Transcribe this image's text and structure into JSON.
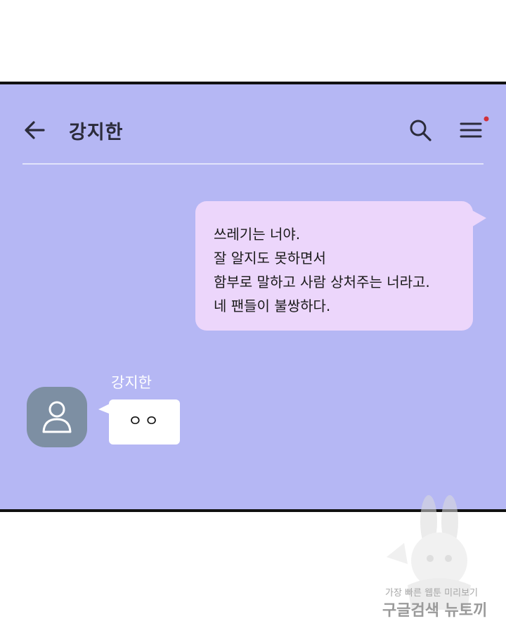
{
  "header": {
    "title": "강지한",
    "back_icon": "arrow-left-icon",
    "search_icon": "search-icon",
    "menu_icon": "hamburger-menu-icon",
    "notification_dot_color": "#d0303a"
  },
  "colors": {
    "panel_background": "#b5b7f4",
    "outgoing_bubble": "#ecd6fb",
    "incoming_bubble": "#ffffff",
    "avatar_background": "#7d8fa3"
  },
  "messages": {
    "outgoing": {
      "lines": [
        "쓰레기는 너야.",
        "잘 알지도 못하면서",
        "함부로 말하고 사람 상처주는 너라고.",
        "네 팬들이 불쌍하다."
      ]
    },
    "incoming": {
      "sender": "강지한",
      "avatar_icon": "person-icon",
      "text": "ㅇㅇ"
    }
  },
  "watermark": {
    "line1": "가장 빠른 웹툰 미리보기",
    "line2": "구글검색 뉴토끼"
  }
}
